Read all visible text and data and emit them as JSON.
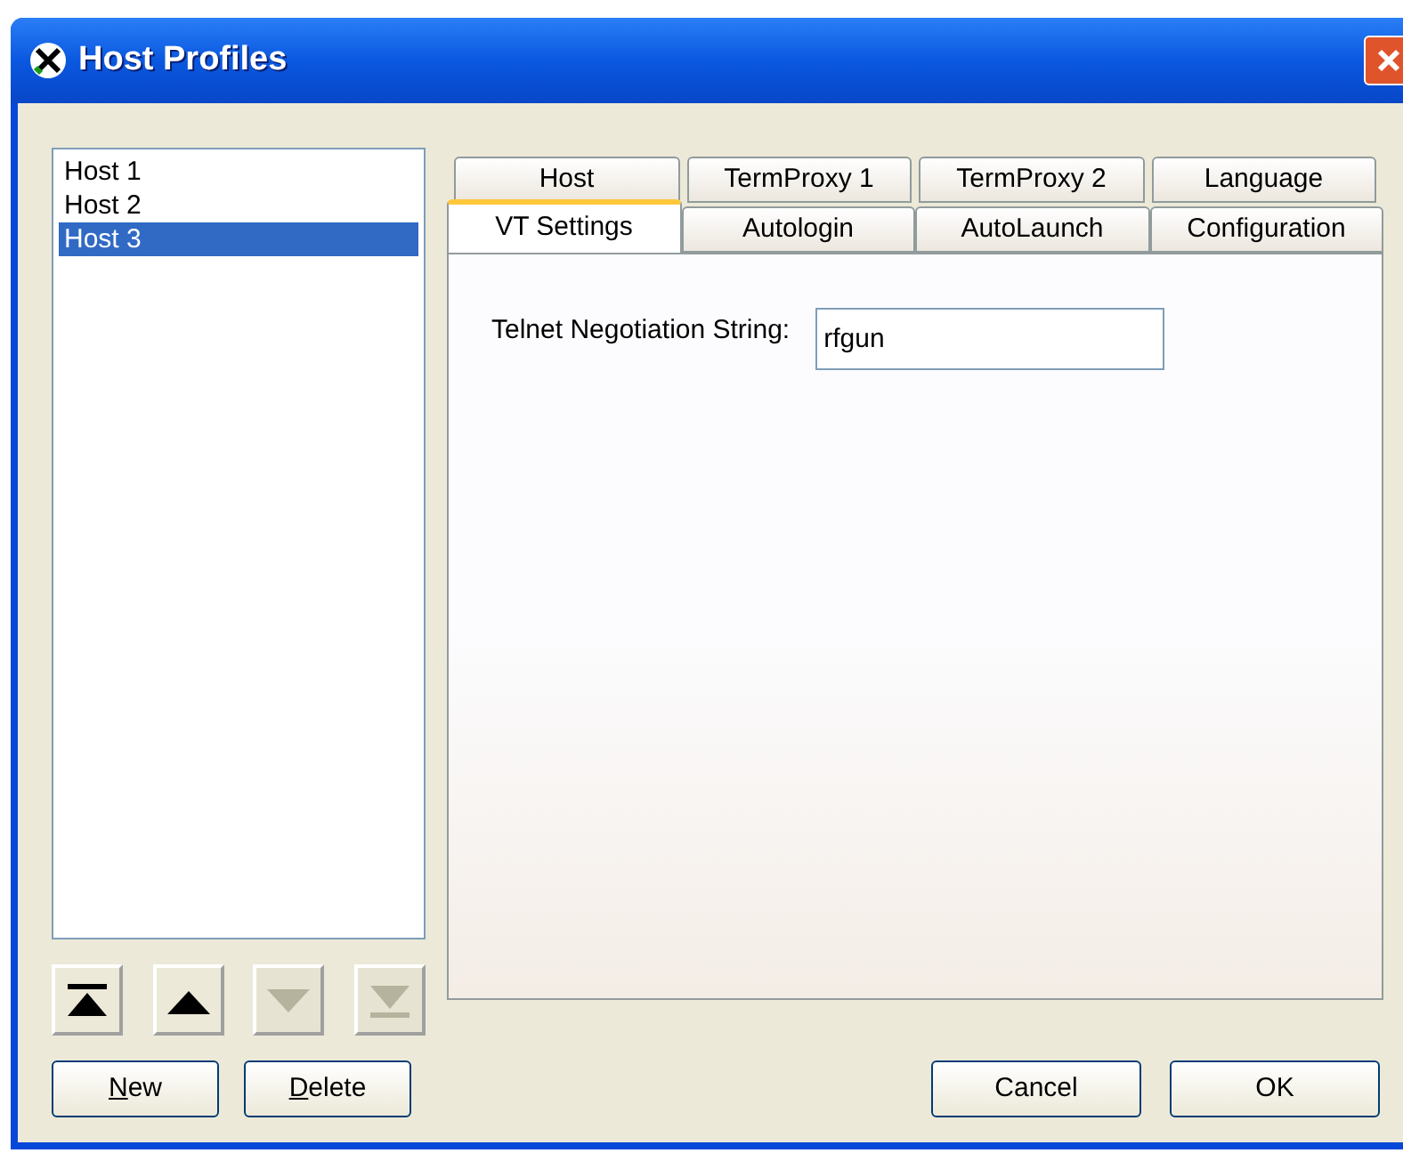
{
  "window": {
    "title": "Host Profiles"
  },
  "hosts": [
    {
      "label": "Host 1",
      "selected": false
    },
    {
      "label": "Host 2",
      "selected": false
    },
    {
      "label": "Host 3",
      "selected": true
    }
  ],
  "move_buttons": [
    {
      "kind": "top",
      "disabled": false
    },
    {
      "kind": "up",
      "disabled": false
    },
    {
      "kind": "down",
      "disabled": true
    },
    {
      "kind": "bottom",
      "disabled": true
    }
  ],
  "tab_rows": [
    [
      {
        "label": "Host",
        "selected": false
      },
      {
        "label": "TermProxy 1",
        "selected": false
      },
      {
        "label": "TermProxy 2",
        "selected": false
      },
      {
        "label": "Language",
        "selected": false
      }
    ],
    [
      {
        "label": "VT Settings",
        "selected": true
      },
      {
        "label": "Autologin",
        "selected": false
      },
      {
        "label": "AutoLaunch",
        "selected": false
      },
      {
        "label": "Configuration",
        "selected": false
      }
    ]
  ],
  "telnet_field": {
    "label": "Telnet Negotiation String:",
    "value": "rfgun"
  },
  "left_buttons": [
    {
      "label": "New",
      "underline_first": true
    },
    {
      "label": "Delete",
      "underline_first": true
    }
  ],
  "right_buttons": [
    {
      "label": "Cancel",
      "underline_first": false
    },
    {
      "label": "OK",
      "underline_first": false
    }
  ]
}
